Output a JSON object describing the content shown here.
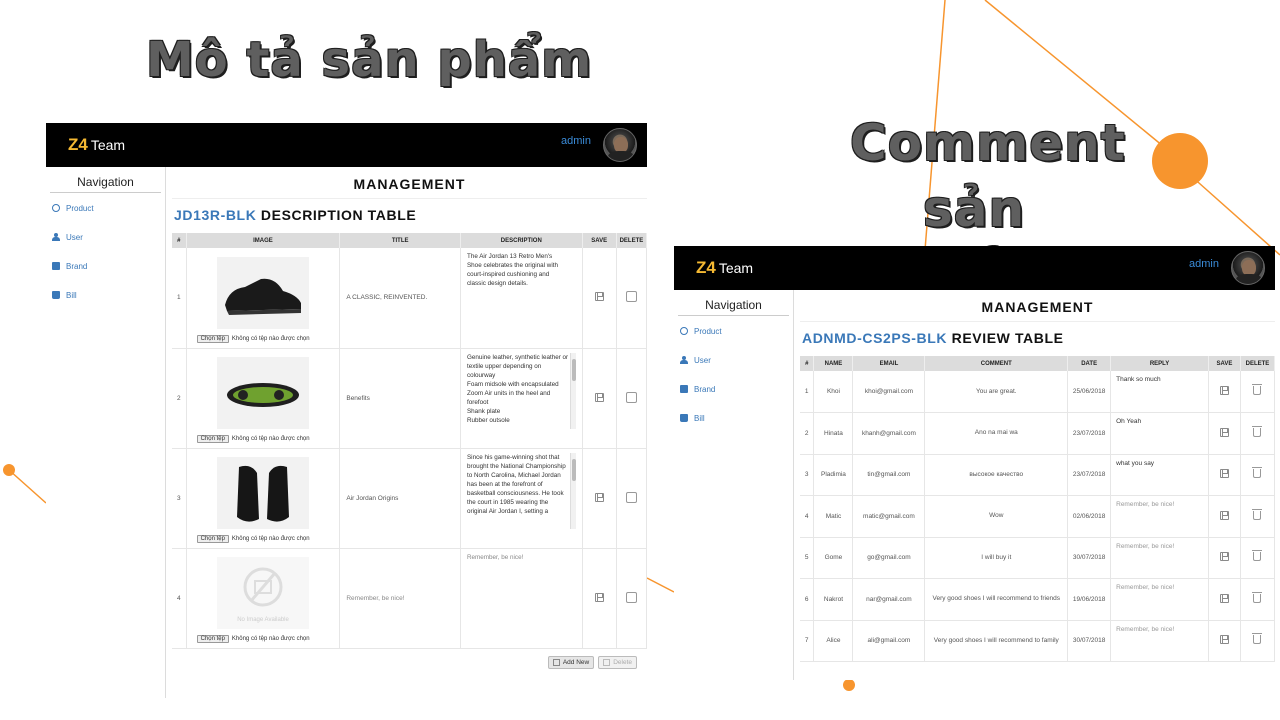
{
  "slide": {
    "title_left": "Mô tả sản phẩm",
    "title_right_line1": "Comment",
    "title_right_line2": "sản phẩm",
    "accent_color": "#f7952e",
    "title_color": "#5f5f5f"
  },
  "app": {
    "brand_mark": "Z4",
    "brand_name": "Team",
    "user": "admin",
    "nav_title": "Navigation",
    "nav_items": [
      {
        "label": "Product",
        "icon": "product-icon"
      },
      {
        "label": "User",
        "icon": "user-icon"
      },
      {
        "label": "Brand",
        "icon": "brand-icon"
      },
      {
        "label": "Bill",
        "icon": "bill-icon"
      }
    ],
    "management": "MANAGEMENT"
  },
  "description_table": {
    "code": "JD13R-BLK",
    "title": "DESCRIPTION TABLE",
    "headers": [
      "#",
      "IMAGE",
      "TITLE",
      "DESCRIPTION",
      "SAVE",
      "DELETE"
    ],
    "file_button": "Chọn tệp",
    "file_status": "Không có tệp nào được chọn",
    "rows": [
      {
        "num": "1",
        "title": "A CLASSIC, REINVENTED.",
        "description": "The Air Jordan 13 Retro Men's Shoe celebrates the original with court-inspired cushioning and classic design details.",
        "image": "black-sneaker-side"
      },
      {
        "num": "2",
        "title": "Benefits",
        "description": " Genuine leather, synthetic leather or textile upper depending on colourway\nFoam midsole with encapsulated Zoom Air units in the heel and forefoot\nShank plate\nRubber outsole",
        "image": "sneaker-sole"
      },
      {
        "num": "3",
        "title": "Air Jordan Origins",
        "description": " Since his game-winning shot that brought the National Championship to North Carolina, Michael Jordan has been at the forefront of basketball consciousness. He took the court in 1985 wearing the original Air Jordan I, setting a",
        "image": "black-sneaker-pair"
      },
      {
        "num": "4",
        "title": "Remember, be nice!",
        "description": "Remember, be nice!",
        "image": "no-image-available",
        "no_image_text": "No Image Available"
      }
    ],
    "add_new": "Add New",
    "delete": "Delete"
  },
  "review_table": {
    "code": "ADNMD-CS2PS-BLK",
    "title": "REVIEW TABLE",
    "headers": [
      "#",
      "NAME",
      "EMAIL",
      "COMMENT",
      "DATE",
      "REPLY",
      "SAVE",
      "DELETE"
    ],
    "rows": [
      {
        "num": "1",
        "name": "Khoi",
        "email": "khoi@gmail.com",
        "comment": "You are great.",
        "date": "25/06/2018",
        "reply": "Thank so much",
        "placeholder": false
      },
      {
        "num": "2",
        "name": "Hinata",
        "email": "khanh@gmail.com",
        "comment": "Ano na mai wa",
        "date": "23/07/2018",
        "reply": "Oh Yeah",
        "placeholder": false
      },
      {
        "num": "3",
        "name": "Pladimia",
        "email": "tin@gmail.com",
        "comment": "высокое качество",
        "date": "23/07/2018",
        "reply": "what you say",
        "placeholder": false
      },
      {
        "num": "4",
        "name": "Matic",
        "email": "matic@gmail.com",
        "comment": "Wow",
        "date": "02/06/2018",
        "reply": "Remember, be nice!",
        "placeholder": true
      },
      {
        "num": "5",
        "name": "Gome",
        "email": "go@gmail.com",
        "comment": "I will buy it",
        "date": "30/07/2018",
        "reply": "Remember, be nice!",
        "placeholder": true
      },
      {
        "num": "6",
        "name": "Nakrot",
        "email": "nar@gmail.com",
        "comment": "Very good shoes I will recommend to friends",
        "date": "19/06/2018",
        "reply": "Remember, be nice!",
        "placeholder": true
      },
      {
        "num": "7",
        "name": "Alice",
        "email": "ali@gmail.com",
        "comment": "Very good shoes I will recommend to family",
        "date": "30/07/2018",
        "reply": "Remember, be nice!",
        "placeholder": true
      }
    ]
  }
}
